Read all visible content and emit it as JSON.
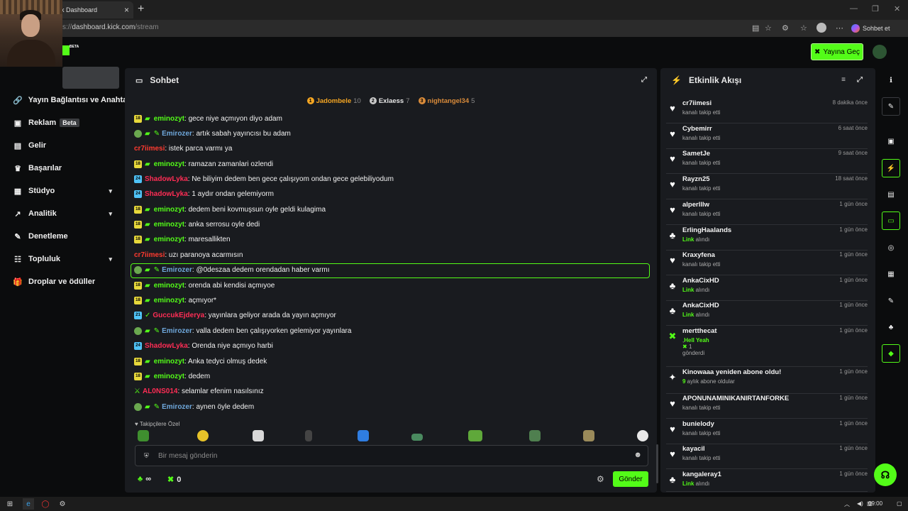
{
  "browser": {
    "tab_title": "k Dashboard",
    "url_prefix": "s://",
    "url_host": "dashboard.kick.com",
    "url_path": "/stream",
    "copilot_label": "Sohbet et"
  },
  "topnav": {
    "go_live_label": "Yayına Geç",
    "logo_badge": "BETA"
  },
  "sidebar": {
    "items": [
      {
        "label": "Yayın Bağlantısı ve Anahtarı",
        "icon": "link-icon"
      },
      {
        "label": "Reklam",
        "badge": "Beta",
        "icon": "ad-icon"
      },
      {
        "label": "Gelir",
        "icon": "revenue-icon"
      },
      {
        "label": "Başarılar",
        "icon": "trophy-icon"
      },
      {
        "label": "Stüdyo",
        "icon": "studio-icon",
        "expandable": true
      },
      {
        "label": "Analitik",
        "icon": "analytics-icon",
        "expandable": true
      },
      {
        "label": "Denetleme",
        "icon": "wrench-icon"
      },
      {
        "label": "Topluluk",
        "icon": "community-icon",
        "expandable": true
      },
      {
        "label": "Droplar ve ödüller",
        "icon": "gift-icon"
      }
    ]
  },
  "chat": {
    "title": "Sohbet",
    "leaderboard": [
      {
        "rank": "1",
        "name": "Jadombele",
        "count": "10",
        "color": "#f5a623"
      },
      {
        "rank": "2",
        "name": "Exlaess",
        "count": "7",
        "color": "#c9c9c9"
      },
      {
        "rank": "3",
        "name": "nightangel34",
        "count": "5",
        "color": "#d98b3a"
      }
    ],
    "messages": [
      {
        "user": "eminozyt",
        "text": ": gece niye açmıyon diyo adam",
        "color": "#53fc18",
        "badges": "sub-mod"
      },
      {
        "user": "Emirozer",
        "text": ": artık sabah yayıncısı bu adam",
        "color": "#6fa8dc",
        "badges": "vip"
      },
      {
        "user": "cr7iimesi",
        "text": ": istek parca varmı ya",
        "color": "#ff3b30",
        "badges": "none"
      },
      {
        "user": "eminozyt",
        "text": ": ramazan zamanlari ozlendi",
        "color": "#53fc18",
        "badges": "sub-mod"
      },
      {
        "user": "ShadowLyka",
        "text": ": Ne biliyim dedem ben gece çalışıyom ondan gece gelebiliyodum",
        "color": "#ff2d55",
        "badges": "sub2"
      },
      {
        "user": "ShadowLyka",
        "text": ": 1 aydır ondan gelemiyorm",
        "color": "#ff2d55",
        "badges": "sub2"
      },
      {
        "user": "eminozyt",
        "text": ": dedem beni kovmuşsun oyle geldi kulagima",
        "color": "#53fc18",
        "badges": "sub-mod"
      },
      {
        "user": "eminozyt",
        "text": ": anka serrosu oyle dedi",
        "color": "#53fc18",
        "badges": "sub-mod"
      },
      {
        "user": "eminozyt",
        "text": ": maresallikten",
        "color": "#53fc18",
        "badges": "sub-mod"
      },
      {
        "user": "cr7iimesi",
        "text": ": uzı paranoya acarmısın",
        "color": "#ff3b30",
        "badges": "none"
      },
      {
        "user": "Emirozer",
        "text": ": @0deszaa dedem orendadan haber varmı",
        "color": "#6fa8dc",
        "badges": "vip"
      },
      {
        "user": "eminozyt",
        "text": ": orenda abi kendisi açmıyoe",
        "color": "#53fc18",
        "badges": "sub-mod"
      },
      {
        "user": "eminozyt",
        "text": ": açmıyor*",
        "color": "#53fc18",
        "badges": "sub-mod"
      },
      {
        "user": "GuccukEjderya",
        "text": ": yayınlara geliyor arada da yayın açmıyor",
        "color": "#ff2d55",
        "badges": "sub3"
      },
      {
        "user": "Emirozer",
        "text": ": valla dedem ben çalışıyorken gelemiyor yayınlara",
        "color": "#6fa8dc",
        "badges": "vip"
      },
      {
        "user": "ShadowLyka",
        "text": ": Orenda niye açmıyo harbi",
        "color": "#ff2d55",
        "badges": "sub2"
      },
      {
        "user": "eminozyt",
        "text": ": Anka tedyci olmuş dedek",
        "color": "#53fc18",
        "badges": "sub-mod"
      },
      {
        "user": "eminozyt",
        "text": ": dedem",
        "color": "#53fc18",
        "badges": "sub-mod"
      },
      {
        "user": "AL0NS014",
        "text": ": selamlar efenim nasılsınız",
        "color": "#ff2d55",
        "badges": "sword"
      },
      {
        "user": "Emirozer",
        "text": ": aynen öyle dedem",
        "color": "#6fa8dc",
        "badges": "vip"
      }
    ],
    "followers_only_label": "Takipçilere Özel",
    "input_placeholder": "Bir mesaj gönderin",
    "points_value": "∞",
    "kicks_value": "0",
    "send_label": "Gönder"
  },
  "feed": {
    "title": "Etkinlik Akışı",
    "events": [
      {
        "name": "cr7iimesi",
        "action": "kanalı takip etti",
        "time": "8 dakika önce",
        "icon": "heart-icon"
      },
      {
        "name": "Cybemirr",
        "action": "kanalı takip etti",
        "time": "6 saat önce",
        "icon": "heart-icon"
      },
      {
        "name": "SametJe",
        "action": "kanalı takip etti",
        "time": "9 saat önce",
        "icon": "heart-icon"
      },
      {
        "name": "Rayzn25",
        "action": "kanalı takip etti",
        "time": "18 saat önce",
        "icon": "heart-icon"
      },
      {
        "name": "alperlllw",
        "action": "kanalı takip etti",
        "time": "1 gün önce",
        "icon": "heart-icon"
      },
      {
        "name": "ErlingHaalands",
        "action_highlight": "Link",
        "action": " alındı",
        "time": "1 gün önce",
        "icon": "reward-icon"
      },
      {
        "name": "Kraxyfena",
        "action": "kanalı takip etti",
        "time": "1 gün önce",
        "icon": "heart-icon"
      },
      {
        "name": "AnkaCixHD",
        "action_highlight": "Link",
        "action": " alındı",
        "time": "1 gün önce",
        "icon": "reward-icon"
      },
      {
        "name": "AnkaCixHD",
        "action_highlight": "Link",
        "action": " alındı",
        "time": "1 gün önce",
        "icon": "reward-icon"
      },
      {
        "name": "mertthecat",
        "action_highlight": "Hell Yeah",
        "action_prefix": ",",
        "kicks": "1",
        "action": "gönderdi",
        "time": "1 gün önce",
        "icon": "kick-icon"
      },
      {
        "name": "Kinowaaa yeniden abone oldu!",
        "action_highlight": "9",
        "action": " aylık abone oldular",
        "time": "1 gün önce",
        "icon": "star-icon"
      },
      {
        "name": "APONUNAMINIKANIRTANFORKE",
        "action": "kanalı takip etti",
        "time": "1 gün önce",
        "icon": "heart-icon"
      },
      {
        "name": "bunielody",
        "action": "kanalı takip etti",
        "time": "1 gün önce",
        "icon": "heart-icon"
      },
      {
        "name": "kayacil",
        "action": "kanalı takip etti",
        "time": "1 gün önce",
        "icon": "heart-icon"
      },
      {
        "name": "kangaleray1",
        "action_highlight": "Link",
        "action": " alındı",
        "time": "1 gün önce",
        "icon": "reward-icon"
      }
    ]
  },
  "taskbar": {
    "time": "09:00"
  },
  "colors": {
    "accent": "#53fc18",
    "panel": "#191b1f",
    "background": "#0b0c0d"
  }
}
